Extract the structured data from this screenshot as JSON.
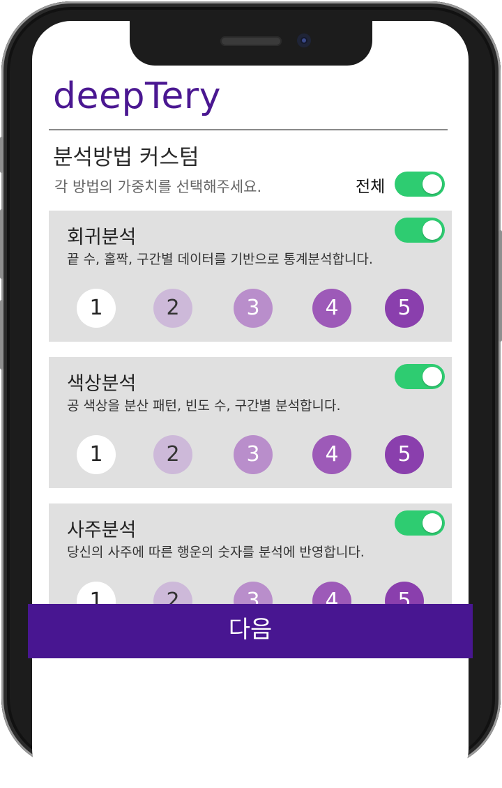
{
  "app": {
    "title": "deepTery"
  },
  "section": {
    "title": "분석방법 커스텀",
    "subtitle": "각 방법의 가중치를 선택해주세요.",
    "all_label": "전체",
    "all_on": true
  },
  "colors": {
    "brand": "#481691",
    "toggle_on": "#2ecc71",
    "card_bg": "#e0e0e0",
    "weight_colors": [
      "#ffffff",
      "#cdb9d9",
      "#b98ecb",
      "#9d5ab8",
      "#8a3fad"
    ]
  },
  "methods": [
    {
      "title": "회귀분석",
      "description": "끝 수, 홀짝, 구간별 데이터를 기반으로 통계분석합니다.",
      "enabled": true,
      "weights": [
        "1",
        "2",
        "3",
        "4",
        "5"
      ]
    },
    {
      "title": "색상분석",
      "description": "공 색상을 분산 패턴, 빈도 수, 구간별 분석합니다.",
      "enabled": true,
      "weights": [
        "1",
        "2",
        "3",
        "4",
        "5"
      ]
    },
    {
      "title": "사주분석",
      "description": "당신의 사주에 따른 행운의 숫자를 분석에 반영합니다.",
      "enabled": true,
      "weights": [
        "1",
        "2",
        "3",
        "4",
        "5"
      ]
    }
  ],
  "next_button": {
    "label": "다음"
  }
}
